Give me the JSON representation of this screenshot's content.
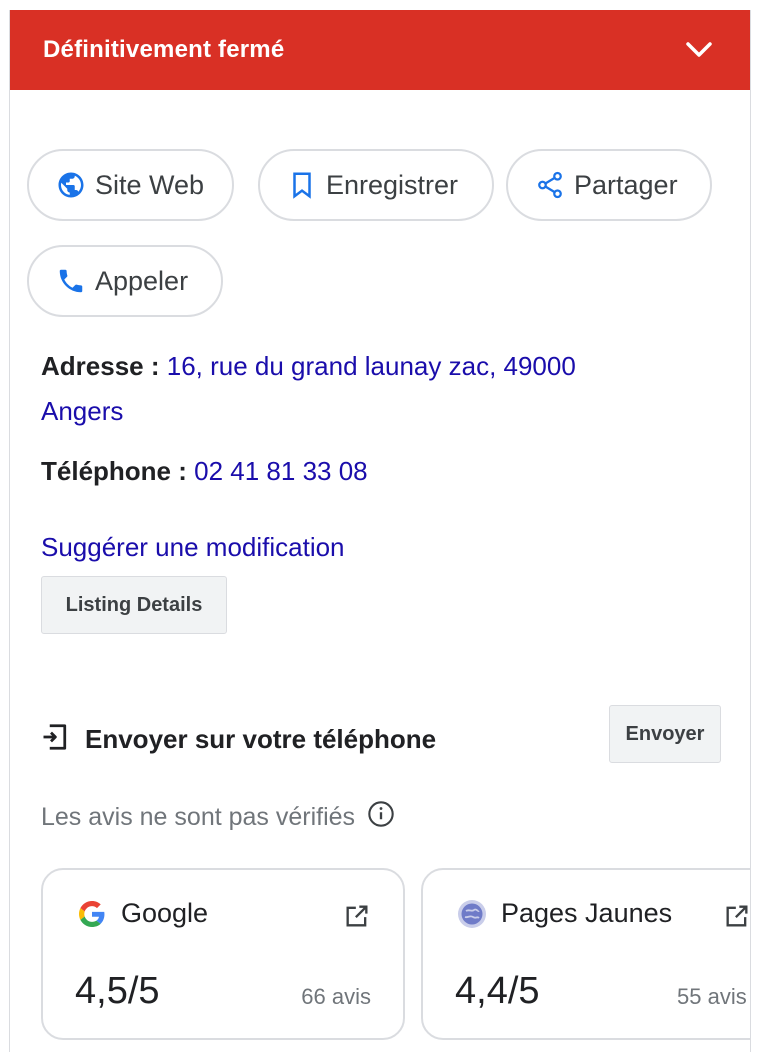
{
  "banner": {
    "title": "Définitivement fermé",
    "icon": "chevron-down-icon"
  },
  "actions": [
    {
      "label": "Site Web",
      "icon": "globe-icon"
    },
    {
      "label": "Enregistrer",
      "icon": "bookmark-icon"
    },
    {
      "label": "Partager",
      "icon": "share-icon"
    },
    {
      "label": "Appeler",
      "icon": "phone-icon"
    }
  ],
  "address": {
    "label": "Adresse :",
    "line1": "16, rue du grand launay zac, 49000",
    "line2": "Angers"
  },
  "phone": {
    "label": "Téléphone :",
    "value": "02 41 81 33 08"
  },
  "suggest_edit": "Suggérer une modification",
  "listing_details": "Listing Details",
  "send_to_phone": {
    "text": "Envoyer sur votre téléphone",
    "button": "Envoyer",
    "icon": "send-to-device-icon"
  },
  "reviews_note": {
    "text": "Les avis ne sont pas vérifiés",
    "icon": "info-icon"
  },
  "reviews": [
    {
      "source": "Google",
      "score": "4,5/5",
      "count": "66 avis",
      "icon": "google-logo-icon"
    },
    {
      "source": "Pages Jaunes",
      "score": "4,4/5",
      "count": "55 avis",
      "icon": "pages-jaunes-logo-icon"
    }
  ],
  "colors": {
    "banner": "#d93025",
    "link": "#1a0dab",
    "icon_blue": "#1a73e8",
    "border": "#dadce0"
  }
}
